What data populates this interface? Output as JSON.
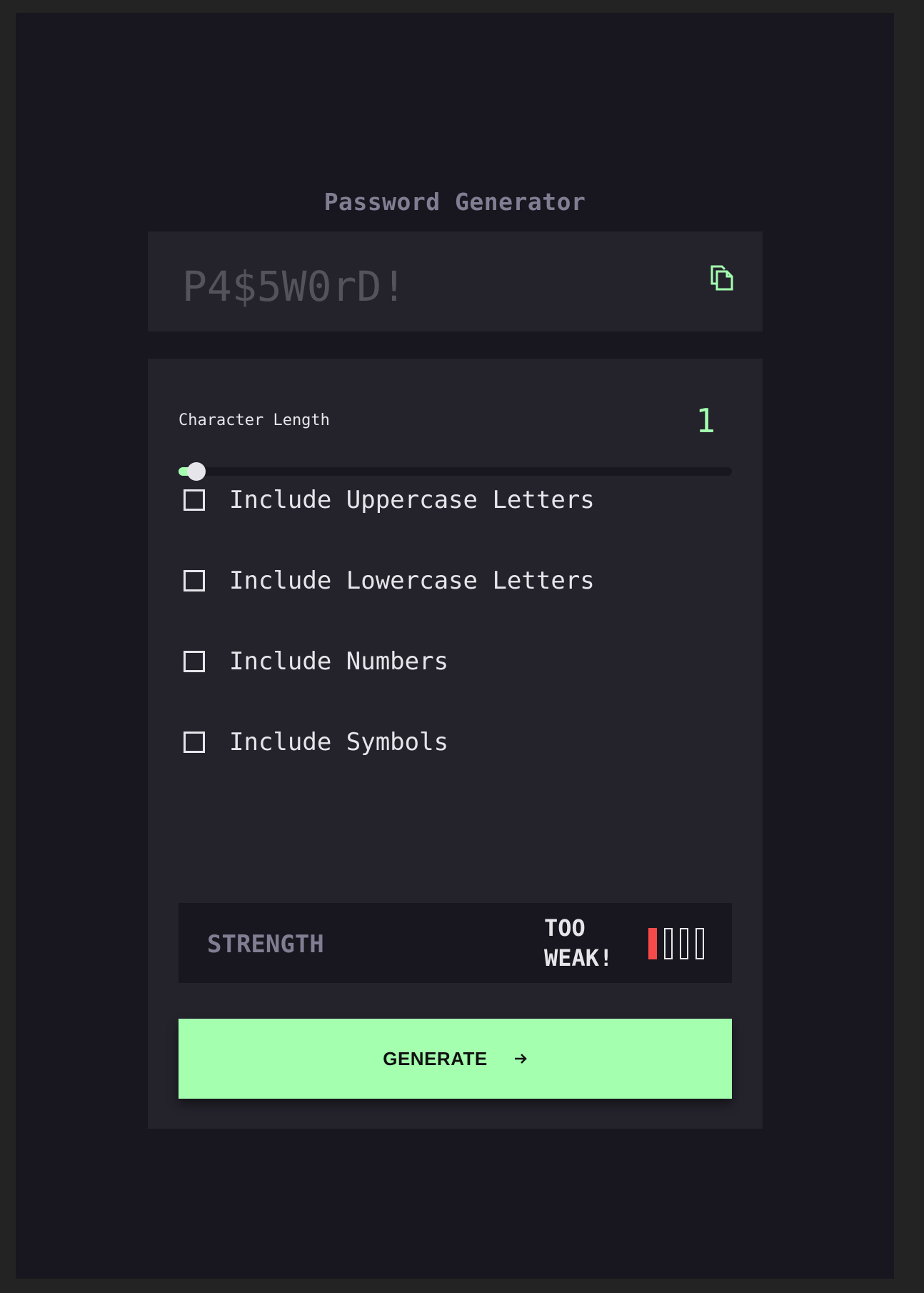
{
  "app": {
    "title": "Password Generator"
  },
  "password": {
    "placeholder": "P4$5W0rD!",
    "copy_icon": "copy-icon"
  },
  "length": {
    "label": "Character Length",
    "value": "1",
    "slider_fraction": 0.0
  },
  "options": [
    {
      "label": "Include Uppercase Letters",
      "checked": false
    },
    {
      "label": "Include Lowercase Letters",
      "checked": false
    },
    {
      "label": "Include Numbers",
      "checked": false
    },
    {
      "label": "Include Symbols",
      "checked": false
    }
  ],
  "strength": {
    "label": "STRENGTH",
    "value": "TOO WEAK!",
    "level": 1,
    "max_level": 4
  },
  "generate": {
    "label": "GENERATE",
    "icon": "arrow-right-icon"
  },
  "colors": {
    "accent": "#a4ffaf",
    "too_weak": "#f64a4a",
    "background": "#18171f",
    "panel": "#24232c",
    "muted": "#817d92",
    "text": "#e6e5ea"
  }
}
